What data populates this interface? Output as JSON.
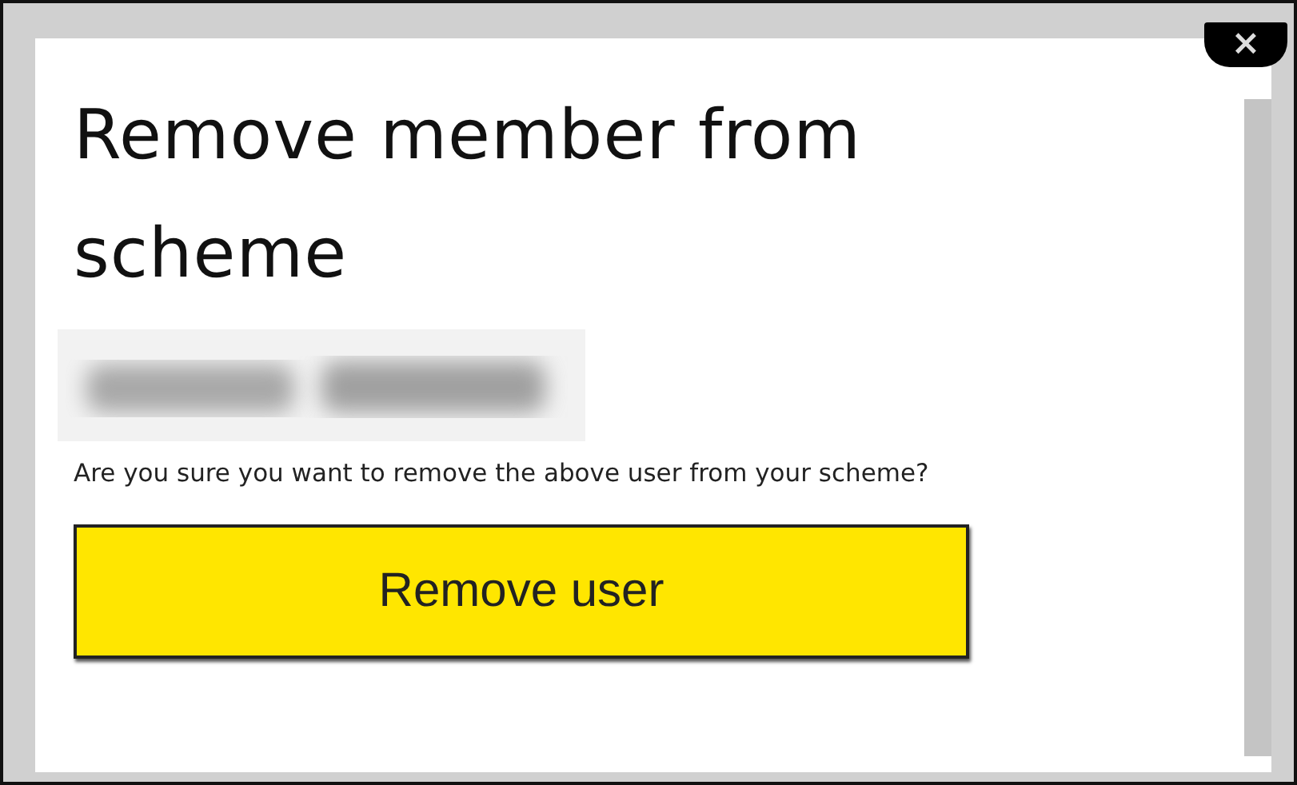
{
  "dialog": {
    "title": "Remove member from scheme",
    "message": "Are you sure you want to remove the above user from your scheme?",
    "close_button": {
      "label": "×"
    },
    "primary_button": {
      "label": "Remove user"
    }
  }
}
